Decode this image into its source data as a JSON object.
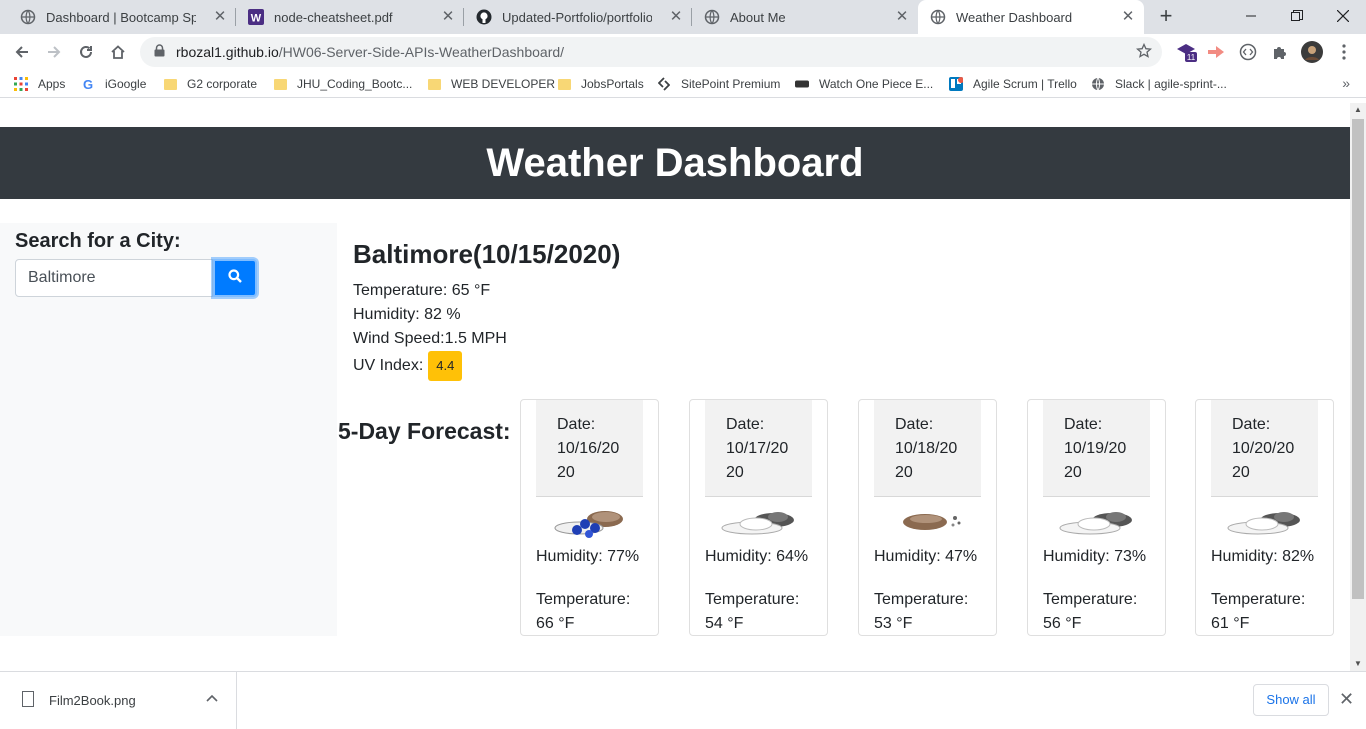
{
  "browser": {
    "tabs": [
      {
        "title": "Dashboard | Bootcamp Spot",
        "icon": "globe-icon"
      },
      {
        "title": "node-cheatsheet.pdf",
        "icon": "w-logo-icon"
      },
      {
        "title": "Updated-Portfolio/portfolio.htm",
        "icon": "github-icon"
      },
      {
        "title": "About Me",
        "icon": "globe-icon"
      },
      {
        "title": "Weather Dashboard",
        "icon": "globe-icon",
        "active": true
      }
    ],
    "address": {
      "host": "rbozal1.github.io",
      "path": "/HW06-Server-Side-APIs-WeatherDashboard/"
    },
    "extension_badge": "11",
    "bookmarks": [
      {
        "label": "Apps",
        "icon": "apps-grid-icon"
      },
      {
        "label": "iGoogle",
        "icon": "google-icon"
      },
      {
        "label": "G2 corporate",
        "icon": "folder-icon"
      },
      {
        "label": "JHU_Coding_Bootc...",
        "icon": "folder-icon"
      },
      {
        "label": "WEB DEVELOPER",
        "icon": "folder-icon"
      },
      {
        "label": "JobsPortals",
        "icon": "folder-icon"
      },
      {
        "label": "SitePoint Premium",
        "icon": "sitepoint-icon"
      },
      {
        "label": "Watch One Piece E...",
        "icon": "site-icon"
      },
      {
        "label": "Agile Scrum | Trello",
        "icon": "trello-icon"
      },
      {
        "label": "Slack | agile-sprint-...",
        "icon": "globe-icon"
      }
    ]
  },
  "page": {
    "title": "Weather Dashboard",
    "sidebar": {
      "heading": "Search for a City:",
      "search_value": "Baltimore"
    },
    "current": {
      "heading": "Baltimore(10/15/2020)",
      "temperature": "Temperature: 65 °F",
      "humidity": "Humidity: 82 %",
      "wind": "Wind Speed:1.5 MPH",
      "uv_label": "UV Index:",
      "uv_value": "4.4",
      "uv_color": "#ffc107"
    },
    "forecast_title": "5-Day Forecast:",
    "forecast": [
      {
        "date_label": "Date:",
        "date": "10/16/2020",
        "icon": "rain-cloud-icon",
        "humidity": "Humidity: 77%",
        "temp_label": "Temperature:",
        "temp": "66 °F"
      },
      {
        "date_label": "Date:",
        "date": "10/17/2020",
        "icon": "broken-clouds-icon",
        "humidity": "Humidity: 64%",
        "temp_label": "Temperature:",
        "temp": "54 °F"
      },
      {
        "date_label": "Date:",
        "date": "10/18/2020",
        "icon": "few-clouds-icon",
        "humidity": "Humidity: 47%",
        "temp_label": "Temperature:",
        "temp": "53 °F"
      },
      {
        "date_label": "Date:",
        "date": "10/19/2020",
        "icon": "broken-clouds-icon",
        "humidity": "Humidity: 73%",
        "temp_label": "Temperature:",
        "temp": "56 °F"
      },
      {
        "date_label": "Date:",
        "date": "10/20/2020",
        "icon": "broken-clouds-icon",
        "humidity": "Humidity: 82%",
        "temp_label": "Temperature:",
        "temp": "61 °F"
      }
    ]
  },
  "downloads": {
    "file": "Film2Book.png",
    "show_all": "Show all"
  }
}
